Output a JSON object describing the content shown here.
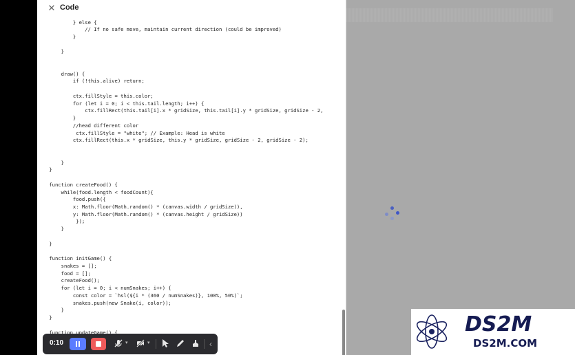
{
  "panel": {
    "title": "Code",
    "close_icon": "x-icon"
  },
  "code_lines": [
    "            } else {",
    "                // If no safe move, maintain current direction (could be improved)",
    "            }",
    "",
    "        }",
    "",
    "",
    "        draw() {",
    "            if (!this.alive) return;",
    "",
    "            ctx.fillStyle = this.color;",
    "            for (let i = 0; i < this.tail.length; i++) {",
    "                ctx.fillRect(this.tail[i].x * gridSize, this.tail[i].y * gridSize, gridSize - 2,",
    "            }",
    "            //head different color",
    "             ctx.fillStyle = \"white\"; // Example: Head is white",
    "            ctx.fillRect(this.x * gridSize, this.y * gridSize, gridSize - 2, gridSize - 2);",
    "",
    "",
    "        }",
    "    }",
    "",
    "    function createFood() {",
    "        while(food.length < foodCount){",
    "            food.push({",
    "            x: Math.floor(Math.random() * (canvas.width / gridSize)),",
    "            y: Math.floor(Math.random() * (canvas.height / gridSize))",
    "             });",
    "        }",
    "",
    "    }",
    "",
    "    function initGame() {",
    "        snakes = [];",
    "        food = [];",
    "        createFood();",
    "        for (let i = 0; i < numSnakes; i++) {",
    "            const color = `hsl(${i * (360 / numSnakes)}, 100%, 50%)`;",
    "            snakes.push(new Snake(i, color));",
    "        }",
    "    }",
    "",
    "    function updateGame() {"
  ],
  "toolbar": {
    "timer": "0:10",
    "pause_icon": "pause-icon",
    "stop_icon": "stop-icon",
    "mic_off_icon": "microphone-off-icon",
    "camera_off_icon": "camera-off-icon",
    "pointer_icon": "cursor-icon",
    "pen_icon": "pen-icon",
    "eraser_icon": "eraser-icon",
    "collapse_icon": "chevron-left-icon"
  },
  "colors": {
    "pause": "#5b7cff",
    "stop": "#ef5a5a",
    "spinner": "#4a5fc1"
  },
  "watermark": {
    "brand": "DS2M",
    "site": "DS2M.COM"
  }
}
